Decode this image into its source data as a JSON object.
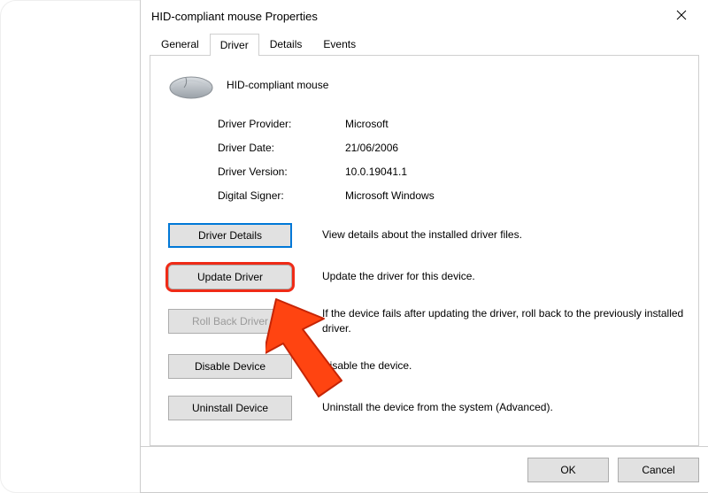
{
  "window": {
    "title": "HID-compliant mouse Properties",
    "close_aria": "Close"
  },
  "tabs": {
    "items": [
      {
        "label": "General"
      },
      {
        "label": "Driver"
      },
      {
        "label": "Details"
      },
      {
        "label": "Events"
      }
    ],
    "selected_index": 1
  },
  "device": {
    "name": "HID-compliant mouse",
    "icon": "mouse-icon"
  },
  "props": {
    "provider_label": "Driver Provider:",
    "provider_value": "Microsoft",
    "date_label": "Driver Date:",
    "date_value": "21/06/2006",
    "version_label": "Driver Version:",
    "version_value": "10.0.19041.1",
    "signer_label": "Digital Signer:",
    "signer_value": "Microsoft Windows"
  },
  "actions": {
    "details": {
      "label": "Driver Details",
      "desc": "View details about the installed driver files."
    },
    "update": {
      "label": "Update Driver",
      "desc": "Update the driver for this device."
    },
    "rollback": {
      "label": "Roll Back Driver",
      "desc": "If the device fails after updating the driver, roll back to the previously installed driver."
    },
    "disable": {
      "label": "Disable Device",
      "desc": "Disable the device."
    },
    "uninstall": {
      "label": "Uninstall Device",
      "desc": "Uninstall the device from the system (Advanced)."
    }
  },
  "bottom": {
    "ok": "OK",
    "cancel": "Cancel"
  },
  "annotation": {
    "arrow_color": "#ff4411",
    "highlight_target": "update-driver-button"
  }
}
